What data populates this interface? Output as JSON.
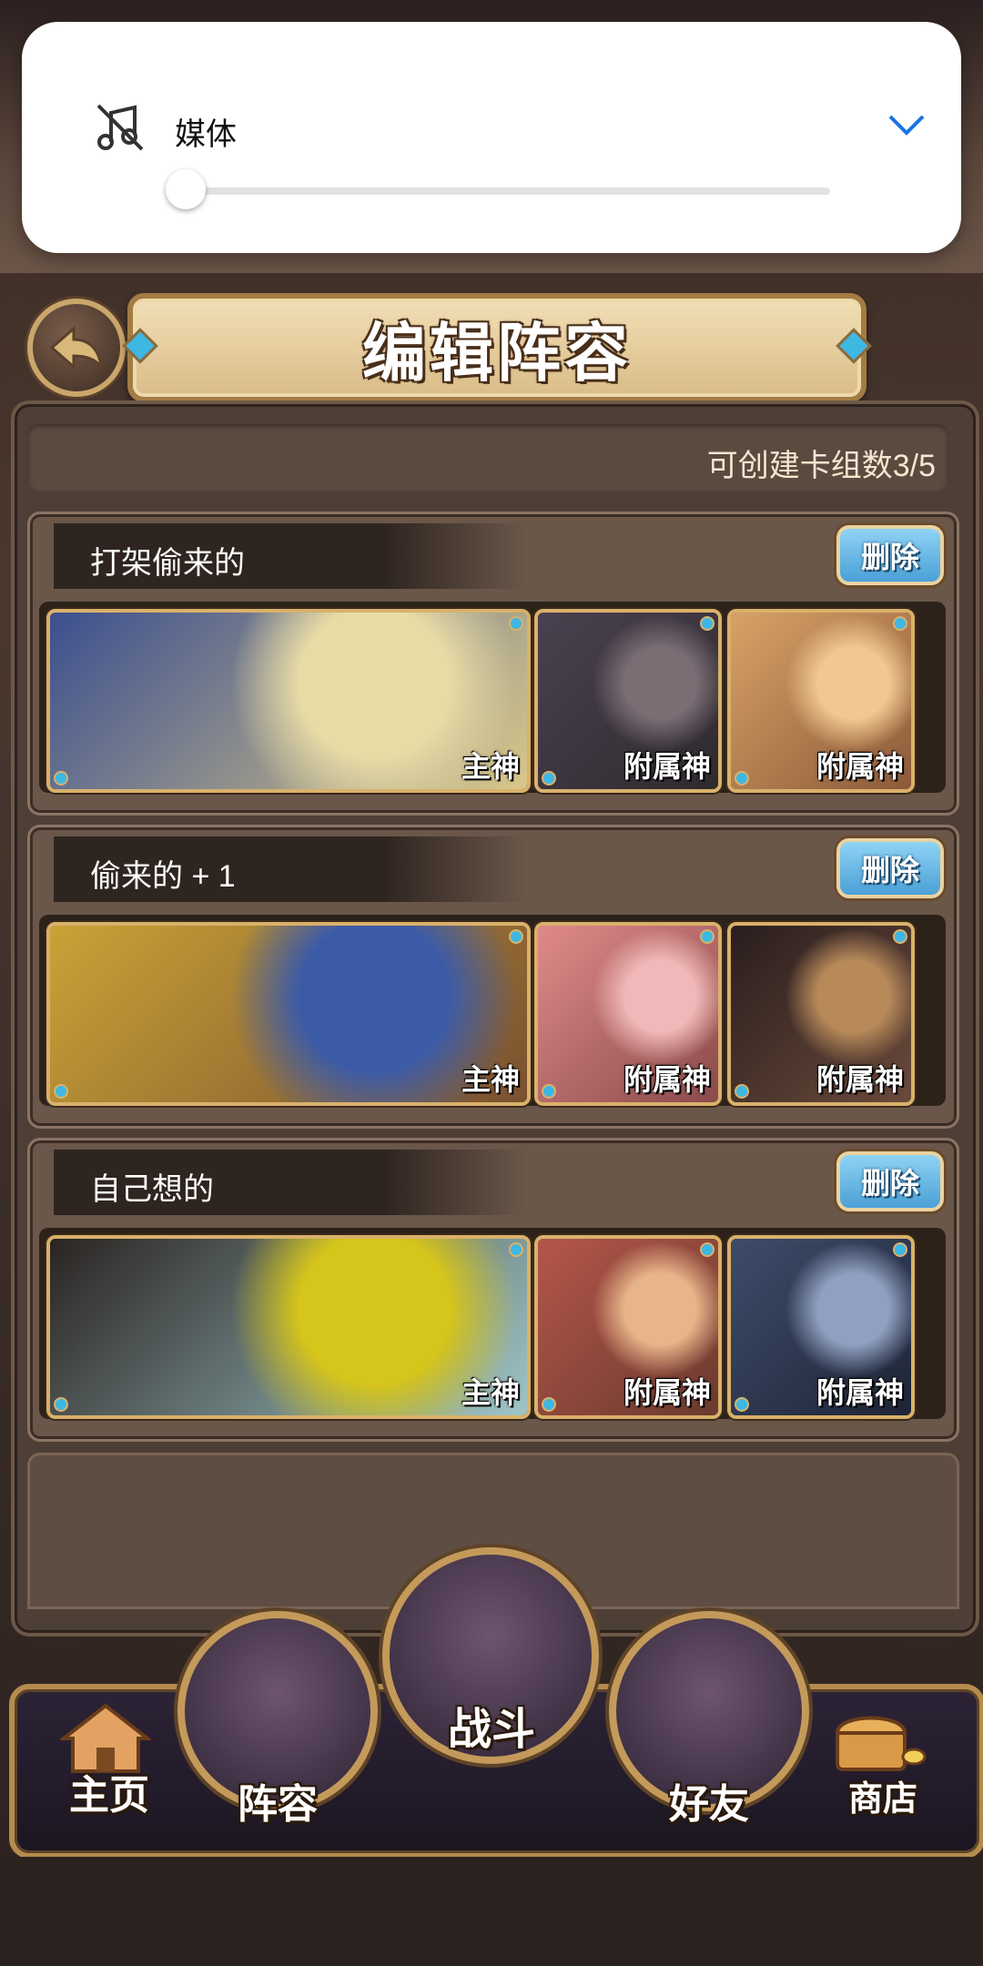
{
  "volume_panel": {
    "label": "媒体",
    "level": 0,
    "icon": "music-muted-icon",
    "expand_icon": "chevron-down-icon"
  },
  "header": {
    "title": "编辑阵容",
    "back_icon": "back-arrow-icon"
  },
  "deck_count": "可创建卡组数3/5",
  "decks": [
    {
      "name": "打架偷来的",
      "delete_label": "删除",
      "cards": [
        {
          "role": "主神",
          "palette": [
            "#3b4f8f",
            "#e8dba6",
            "#d9c88a"
          ]
        },
        {
          "role": "附属神",
          "palette": [
            "#4a4150",
            "#7a6e74",
            "#2f2a2e"
          ]
        },
        {
          "role": "附属神",
          "palette": [
            "#d8a266",
            "#f0c890",
            "#8c5a3a"
          ]
        }
      ]
    },
    {
      "name": "偷来的 + 1",
      "delete_label": "删除",
      "cards": [
        {
          "role": "主神",
          "palette": [
            "#c9a336",
            "#3c5ba7",
            "#7a5030"
          ]
        },
        {
          "role": "附属神",
          "palette": [
            "#e08a8a",
            "#f0b8b8",
            "#8a4a4a"
          ]
        },
        {
          "role": "附属神",
          "palette": [
            "#2a1e1e",
            "#b88a5a",
            "#6a4a3a"
          ]
        }
      ]
    },
    {
      "name": "自己想的",
      "delete_label": "删除",
      "cards": [
        {
          "role": "主神",
          "palette": [
            "#2a2422",
            "#d6c51a",
            "#9fc6c8"
          ]
        },
        {
          "role": "附属神",
          "palette": [
            "#b5564a",
            "#e8b48a",
            "#6a3a2e"
          ]
        },
        {
          "role": "附属神",
          "palette": [
            "#3e4c6a",
            "#8fa0c0",
            "#1e2436"
          ]
        }
      ]
    }
  ],
  "nav": {
    "home": "主页",
    "lineup": "阵容",
    "battle": "战斗",
    "friends": "好友",
    "shop": "商店"
  },
  "colors": {
    "accent_gold": "#c49a5a",
    "delete_blue": "#4aa0d6",
    "panel_brown": "#6a574a"
  }
}
